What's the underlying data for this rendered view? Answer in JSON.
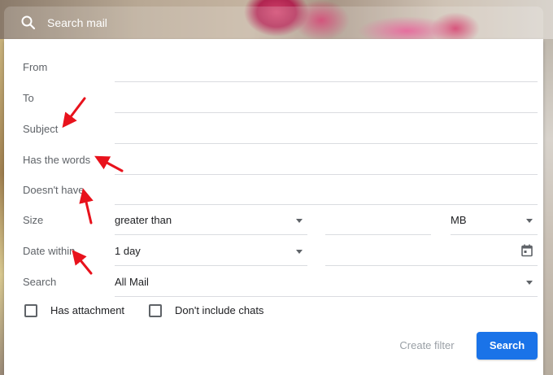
{
  "search": {
    "placeholder": "Search mail",
    "icon": "search-icon"
  },
  "form": {
    "from": {
      "label": "From",
      "value": ""
    },
    "to": {
      "label": "To",
      "value": ""
    },
    "subject": {
      "label": "Subject",
      "value": ""
    },
    "has_words": {
      "label": "Has the words",
      "value": ""
    },
    "doesnt_have": {
      "label": "Doesn't have",
      "value": ""
    },
    "size": {
      "label": "Size",
      "comparator": "greater than",
      "value": "",
      "unit": "MB"
    },
    "date_within": {
      "label": "Date within",
      "range": "1 day",
      "date": "",
      "icon": "calendar-icon"
    },
    "search_in": {
      "label": "Search",
      "value": "All Mail"
    },
    "has_attachment": {
      "label": "Has attachment",
      "checked": false
    },
    "no_chats": {
      "label": "Don't include chats",
      "checked": false
    }
  },
  "actions": {
    "create_filter": "Create filter",
    "search": "Search"
  },
  "colors": {
    "primary": "#1a73e8",
    "annotation_arrow": "#e8121c"
  }
}
